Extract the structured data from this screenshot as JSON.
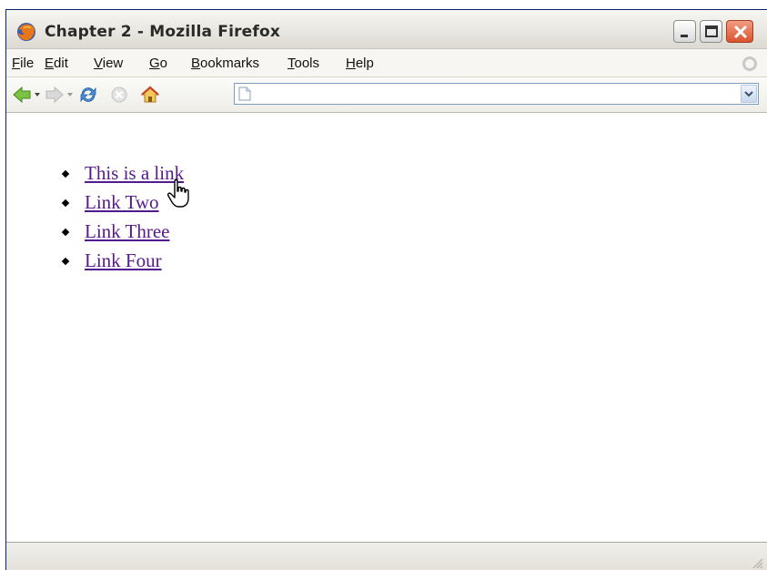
{
  "window": {
    "title": "Chapter 2 - Mozilla Firefox"
  },
  "menubar": {
    "items": [
      {
        "label": "File",
        "accel": "F",
        "rest": "ile"
      },
      {
        "label": "Edit",
        "accel": "E",
        "rest": "dit"
      },
      {
        "label": "View",
        "accel": "V",
        "rest": "iew"
      },
      {
        "label": "Go",
        "accel": "G",
        "rest": "o"
      },
      {
        "label": "Bookmarks",
        "accel": "B",
        "rest": "ookmarks"
      },
      {
        "label": "Tools",
        "accel": "T",
        "rest": "ools"
      },
      {
        "label": "Help",
        "accel": "H",
        "rest": "elp"
      }
    ]
  },
  "toolbar": {
    "icons": [
      "back-arrow-icon",
      "forward-arrow-icon",
      "reload-icon",
      "stop-icon",
      "home-icon"
    ],
    "url": {
      "value": "",
      "placeholder": ""
    }
  },
  "content": {
    "links": [
      {
        "label": "This is a link"
      },
      {
        "label": "Link Two"
      },
      {
        "label": "Link Three"
      },
      {
        "label": "Link Four"
      }
    ]
  },
  "statusbar": {
    "text": ""
  },
  "colors": {
    "link": "#551a8b",
    "titlebar_close": "#d9542e",
    "url_border": "#7f9db9"
  }
}
